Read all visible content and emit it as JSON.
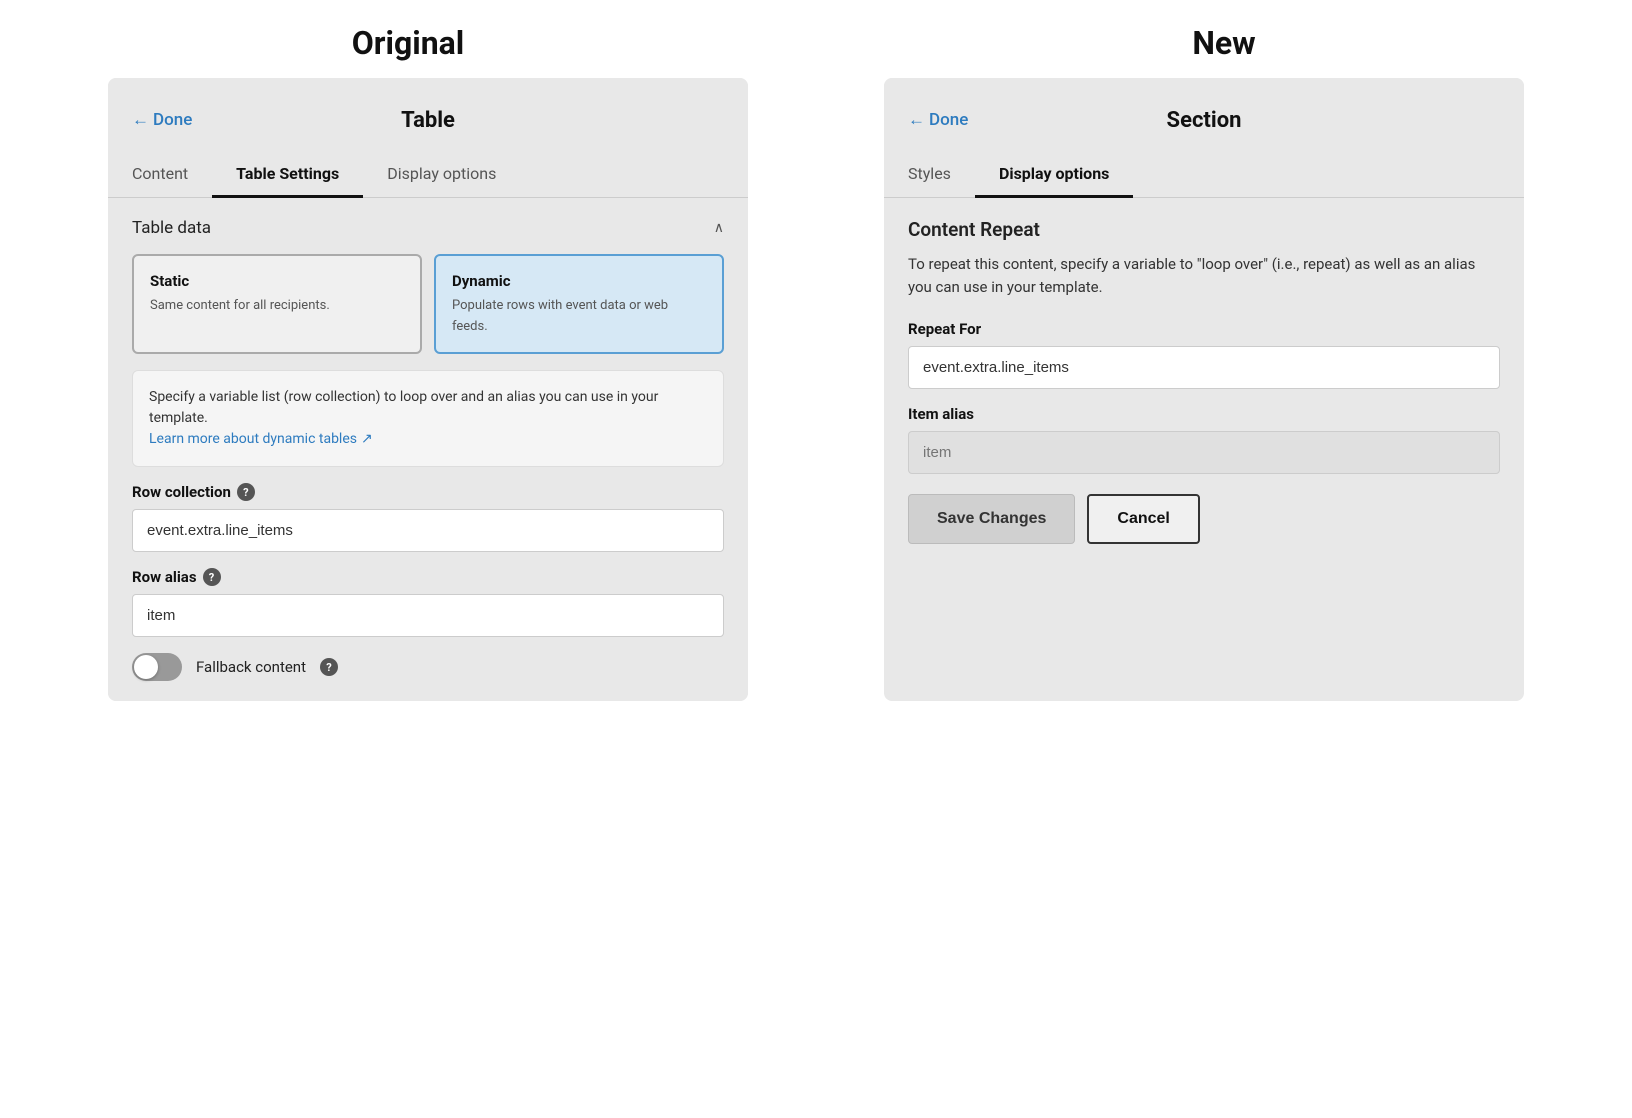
{
  "comparison": {
    "original_label": "Original",
    "new_label": "New"
  },
  "left_panel": {
    "done_label": "Done",
    "title": "Table",
    "tabs": [
      {
        "label": "Content",
        "active": false
      },
      {
        "label": "Table Settings",
        "active": true
      },
      {
        "label": "Display options",
        "active": false
      }
    ],
    "section_title": "Table data",
    "static_btn": {
      "title": "Static",
      "desc": "Same content for all recipients."
    },
    "dynamic_btn": {
      "title": "Dynamic",
      "desc": "Populate rows with event data or web feeds."
    },
    "info_text": "Specify a variable list (row collection) to loop over and an alias you can use in your template.",
    "info_link": "Learn more about dynamic tables",
    "row_collection_label": "Row collection",
    "row_collection_help": "?",
    "row_collection_value": "event.extra.line_items",
    "row_alias_label": "Row alias",
    "row_alias_help": "?",
    "row_alias_value": "item",
    "fallback_label": "Fallback content",
    "fallback_help": "?"
  },
  "right_panel": {
    "done_label": "Done",
    "title": "Section",
    "tabs": [
      {
        "label": "Styles",
        "active": false
      },
      {
        "label": "Display options",
        "active": true
      }
    ],
    "content_repeat_title": "Content Repeat",
    "content_repeat_desc": "To repeat this content, specify a variable to \"loop over\" (i.e., repeat) as well as an alias you can use in your template.",
    "repeat_for_label": "Repeat For",
    "repeat_for_value": "event.extra.line_items",
    "item_alias_label": "Item alias",
    "item_alias_placeholder": "item",
    "save_changes_label": "Save Changes",
    "cancel_label": "Cancel"
  }
}
